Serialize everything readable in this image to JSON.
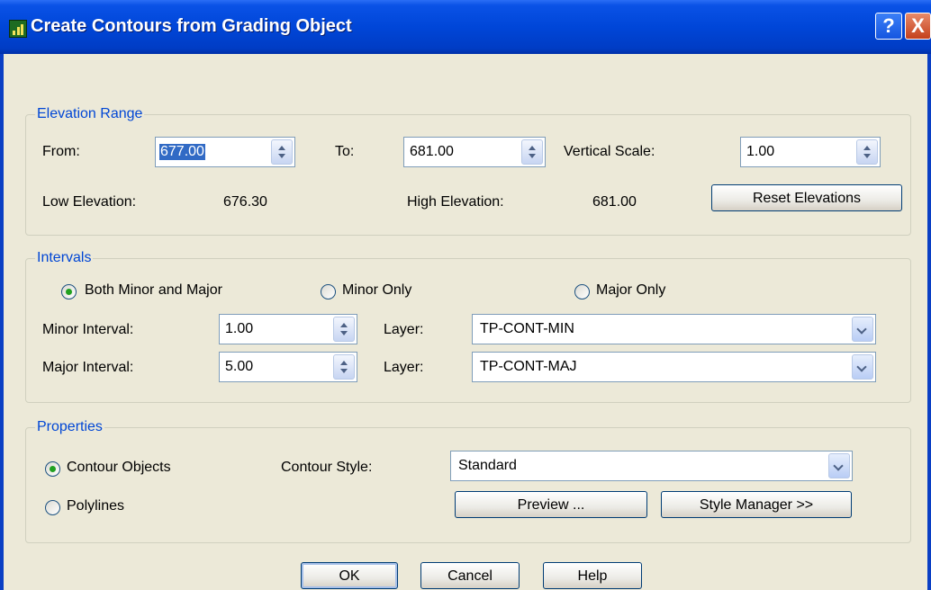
{
  "window": {
    "title": "Create Contours from Grading Object"
  },
  "titlebar": {
    "help_glyph": "?",
    "close_glyph": "X"
  },
  "elevation_range": {
    "legend": "Elevation Range",
    "from_label": "From:",
    "from_value": "677.00",
    "to_label": "To:",
    "to_value": "681.00",
    "vertical_scale_label": "Vertical Scale:",
    "vertical_scale_value": "1.00",
    "low_label": "Low Elevation:",
    "low_value": "676.30",
    "high_label": "High Elevation:",
    "high_value": "681.00",
    "reset_button": "Reset Elevations"
  },
  "intervals": {
    "legend": "Intervals",
    "options": [
      "Both Minor and Major",
      "Minor Only",
      "Major Only"
    ],
    "selected_option": "Both Minor and Major",
    "minor_label": "Minor Interval:",
    "minor_value": "1.00",
    "minor_layer_label": "Layer:",
    "minor_layer_value": "TP-CONT-MIN",
    "major_label": "Major Interval:",
    "major_value": "5.00",
    "major_layer_label": "Layer:",
    "major_layer_value": "TP-CONT-MAJ"
  },
  "properties": {
    "legend": "Properties",
    "options": [
      "Contour Objects",
      "Polylines"
    ],
    "selected_option": "Contour Objects",
    "style_label": "Contour Style:",
    "style_value": "Standard",
    "preview_button": "Preview ...",
    "style_manager_button": "Style Manager >>"
  },
  "footer": {
    "ok": "OK",
    "cancel": "Cancel",
    "help": "Help"
  },
  "colors": {
    "titlebar": "#0046d8",
    "dialog_bg": "#ece9d8",
    "legend": "#0046d5",
    "selection": "#316ac5"
  }
}
